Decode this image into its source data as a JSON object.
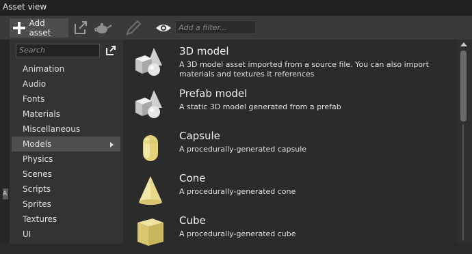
{
  "window": {
    "title": "Asset view"
  },
  "toolbar": {
    "add_label": "Add asset",
    "filter_placeholder": "Add a filter...",
    "icons": [
      "plus-icon",
      "import-icon",
      "teapot-icon",
      "pencil-icon",
      "eye-icon"
    ]
  },
  "sidebar": {
    "search_placeholder": "Search",
    "categories": [
      {
        "label": "Animation"
      },
      {
        "label": "Audio"
      },
      {
        "label": "Fonts"
      },
      {
        "label": "Materials"
      },
      {
        "label": "Miscellaneous"
      },
      {
        "label": "Models",
        "selected": true
      },
      {
        "label": "Physics"
      },
      {
        "label": "Scenes"
      },
      {
        "label": "Scripts"
      },
      {
        "label": "Sprites"
      },
      {
        "label": "Textures"
      },
      {
        "label": "UI"
      }
    ]
  },
  "assets": [
    {
      "name": "3D model",
      "description": "A 3D model asset imported from a source file. You can also import materials and textures it references",
      "icon": "model-shapes-icon"
    },
    {
      "name": "Prefab model",
      "description": "A static 3D model generated from a prefab",
      "icon": "prefab-shapes-icon"
    },
    {
      "name": "Capsule",
      "description": "A procedurally-generated capsule",
      "icon": "capsule-icon"
    },
    {
      "name": "Cone",
      "description": "A procedurally-generated cone",
      "icon": "cone-icon"
    },
    {
      "name": "Cube",
      "description": "A procedurally-generated cube",
      "icon": "cube-icon"
    }
  ],
  "colors": {
    "accent_yellow": "#e8d88a",
    "panel": "#333333",
    "selection": "#4e4e4e"
  },
  "left_edge_chip": "A"
}
